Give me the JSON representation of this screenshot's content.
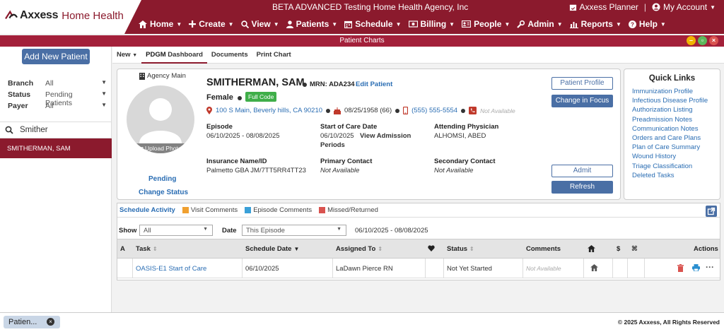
{
  "header": {
    "logo_brand": "Axxess",
    "logo_product": "Home Health",
    "agency_title": "BETA ADVANCED Testing Home Health Agency, Inc",
    "planner_label": "Axxess Planner",
    "separator": "|",
    "account_label": "My Account",
    "nav": [
      {
        "label": "Home",
        "icon": "home-icon"
      },
      {
        "label": "Create",
        "icon": "plus-icon"
      },
      {
        "label": "View",
        "icon": "search-icon"
      },
      {
        "label": "Patients",
        "icon": "person-icon"
      },
      {
        "label": "Schedule",
        "icon": "calendar-icon"
      },
      {
        "label": "Billing",
        "icon": "money-icon"
      },
      {
        "label": "People",
        "icon": "id-card-icon"
      },
      {
        "label": "Admin",
        "icon": "wrench-icon"
      },
      {
        "label": "Reports",
        "icon": "bar-chart-icon"
      },
      {
        "label": "Help",
        "icon": "question-icon"
      }
    ]
  },
  "window": {
    "title": "Patient Charts",
    "colors": {
      "minimize": "#f0b400",
      "maximize": "#5cb85c",
      "close": "#d9534f"
    }
  },
  "sidebar": {
    "add_button": "Add New Patient",
    "filters": [
      {
        "label": "Branch",
        "value": "All"
      },
      {
        "label": "Status",
        "value": "Pending Patients"
      },
      {
        "label": "Payer",
        "value": "All"
      }
    ],
    "search_value": "Smither",
    "patients": [
      "SMITHERMAN, SAM"
    ]
  },
  "tabs": {
    "new": "New",
    "pdgm_prefix": "PDGM",
    "pdgm_suffix": " Dashboard",
    "documents": "Documents",
    "print_chart": "Print Chart"
  },
  "patient": {
    "agency": "Agency Main",
    "upload_photo": "Upload Photo",
    "status": "Pending",
    "change_status": "Change Status",
    "name": "SMITHERMAN, SAM",
    "mrn": "MRN: ADA234",
    "edit": "Edit Patient",
    "gender": "Female",
    "code_status": "Full Code",
    "address": "100 S Main, Beverly hills, CA 90210",
    "dob": "08/25/1958 (66)",
    "phone": "(555) 555-5554",
    "alt_phone": "Not Available",
    "episode_label": "Episode",
    "episode_value": "06/10/2025 - 08/08/2025",
    "soc_label": "Start of Care Date",
    "soc_value": "06/10/2025",
    "admission_periods_1": "View Admission",
    "admission_periods_2": "Periods",
    "physician_label": "Attending Physician",
    "physician_value": "ALHOMSI, ABED",
    "insurance_label": "Insurance Name/ID",
    "insurance_value": "Palmetto GBA JM/7TT5RR4TT23",
    "primary_label": "Primary Contact",
    "primary_value": "Not Available",
    "secondary_label": "Secondary Contact",
    "secondary_value": "Not Available",
    "btn_profile": "Patient Profile",
    "btn_focus": "Change in Focus",
    "btn_admit": "Admit",
    "btn_refresh": "Refresh"
  },
  "quick_links": {
    "title": "Quick Links",
    "items": [
      "Immunization Profile",
      "Infectious Disease Profile",
      "Authorization Listing",
      "Preadmission Notes",
      "Communication Notes",
      "Orders and Care Plans",
      "Plan of Care Summary",
      "Wound History",
      "Triage Classification",
      "Deleted Tasks"
    ]
  },
  "schedule": {
    "title": "Schedule Activity",
    "legend": [
      {
        "label": "Visit Comments",
        "color": "#f0a030"
      },
      {
        "label": "Episode Comments",
        "color": "#3aa0d8"
      },
      {
        "label": "Missed/Returned",
        "color": "#d9534f"
      }
    ],
    "show_label": "Show",
    "show_value": "All",
    "date_label": "Date",
    "date_value": "This Episode",
    "date_range": "06/10/2025 - 08/08/2025",
    "columns": [
      "A",
      "Task",
      "Schedule Date",
      "Assigned To",
      "Status",
      "Comments",
      "Actions"
    ],
    "rows": [
      {
        "task": "OASIS-E1 Start of Care",
        "date": "06/10/2025",
        "assigned": "LaDawn Pierce RN",
        "status": "Not Yet Started",
        "comments": "Not Available"
      }
    ]
  },
  "footer": {
    "tab_label": "Patien...",
    "copyright": "© 2025 Axxess, All Rights Reserved"
  }
}
